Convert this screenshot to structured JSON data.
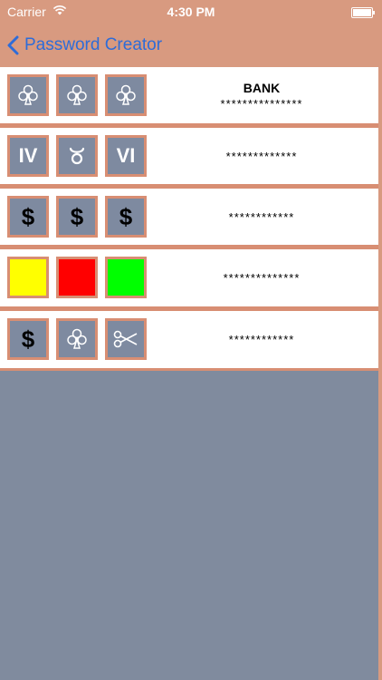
{
  "status_bar": {
    "carrier": "Carrier",
    "time": "4:30 PM"
  },
  "nav": {
    "back_label": "Password Creator"
  },
  "colors": {
    "header": "#d89a80",
    "accent": "#2e6cd8",
    "tile_bg": "#7e8aa0",
    "tile_border": "#d88e73",
    "background": "#808b9e"
  },
  "rows": [
    {
      "name": "BANK",
      "mask": "***************",
      "tiles": [
        {
          "type": "icon",
          "icon": "club-icon"
        },
        {
          "type": "icon",
          "icon": "club-icon"
        },
        {
          "type": "icon",
          "icon": "club-icon"
        }
      ]
    },
    {
      "name": "",
      "mask": "*************",
      "tiles": [
        {
          "type": "text",
          "text": "IV"
        },
        {
          "type": "icon",
          "icon": "taurus-icon"
        },
        {
          "type": "text",
          "text": "VI"
        }
      ]
    },
    {
      "name": "",
      "mask": "************",
      "tiles": [
        {
          "type": "text",
          "text": "$"
        },
        {
          "type": "text",
          "text": "$"
        },
        {
          "type": "text",
          "text": "$"
        }
      ]
    },
    {
      "name": "",
      "mask": "**************",
      "tiles": [
        {
          "type": "color",
          "color": "#ffff00"
        },
        {
          "type": "color",
          "color": "#ff0000"
        },
        {
          "type": "color",
          "color": "#00ff00"
        }
      ]
    },
    {
      "name": "",
      "mask": "************",
      "tiles": [
        {
          "type": "text",
          "text": "$"
        },
        {
          "type": "icon",
          "icon": "club-icon"
        },
        {
          "type": "icon",
          "icon": "scissors-icon"
        }
      ]
    }
  ]
}
